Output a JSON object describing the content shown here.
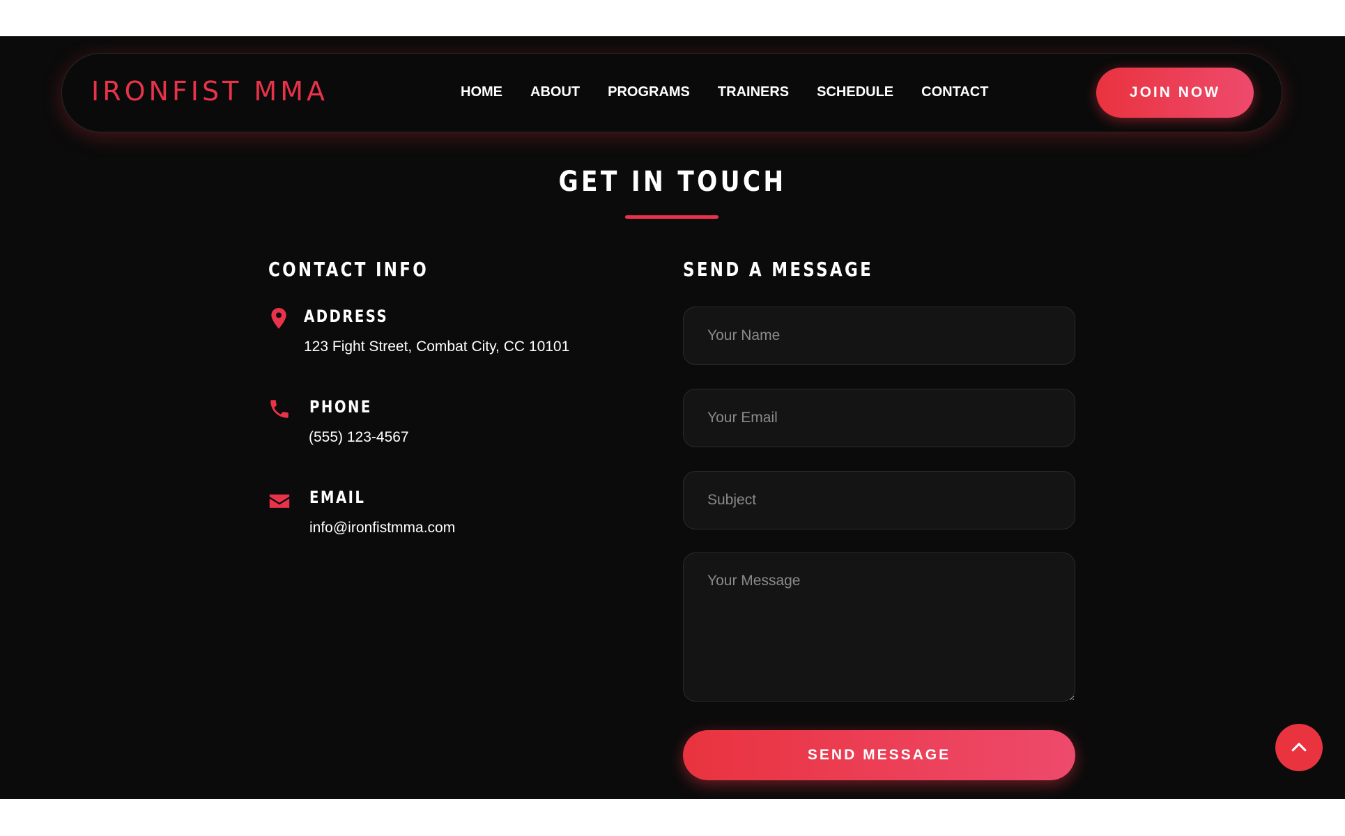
{
  "brand": {
    "logo": "IRONFIST MMA",
    "accent": "#e9334a"
  },
  "nav": {
    "items": [
      "HOME",
      "ABOUT",
      "PROGRAMS",
      "TRAINERS",
      "SCHEDULE",
      "CONTACT"
    ],
    "join_label": "JOIN NOW"
  },
  "section": {
    "title": "GET IN TOUCH"
  },
  "contact_info": {
    "heading": "CONTACT INFO",
    "address": {
      "icon": "map-pin-icon",
      "label": "ADDRESS",
      "value": "123 Fight Street, Combat City, CC 10101"
    },
    "phone": {
      "icon": "phone-icon",
      "label": "PHONE",
      "value": "(555) 123-4567"
    },
    "email": {
      "icon": "envelope-icon",
      "label": "EMAIL",
      "value": "info@ironfistmma.com"
    }
  },
  "form": {
    "heading": "SEND A MESSAGE",
    "name_placeholder": "Your Name",
    "email_placeholder": "Your Email",
    "subject_placeholder": "Subject",
    "message_placeholder": "Your Message",
    "submit_label": "SEND MESSAGE"
  },
  "scroll_top": {
    "icon": "chevron-up-icon"
  }
}
